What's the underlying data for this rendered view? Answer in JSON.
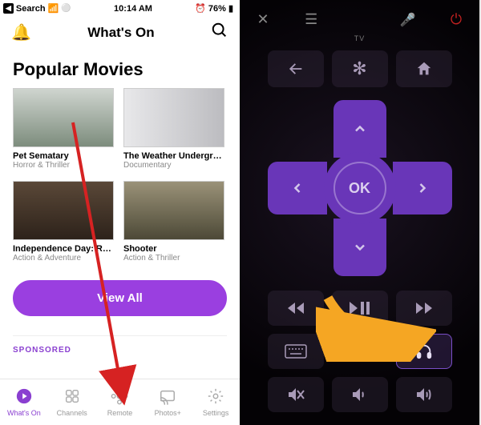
{
  "status": {
    "back": "Search",
    "time": "10:14 AM",
    "battery": "76%",
    "alarm": "⏰"
  },
  "header": {
    "title": "What's On"
  },
  "section_title": "Popular Movies",
  "movies": [
    {
      "title": "Pet Sematary",
      "genre": "Horror & Thriller"
    },
    {
      "title": "The Weather Undergro…",
      "genre": "Documentary"
    },
    {
      "title": "Independence Day: Res…",
      "genre": "Action & Adventure"
    },
    {
      "title": "Shooter",
      "genre": "Action & Thriller"
    }
  ],
  "view_all": "View All",
  "sponsored": "SPONSORED",
  "tabs": [
    {
      "label": "What's On"
    },
    {
      "label": "Channels"
    },
    {
      "label": "Remote"
    },
    {
      "label": "Photos+"
    },
    {
      "label": "Settings"
    }
  ],
  "remote": {
    "tv_label": "TV",
    "ok": "OK",
    "asterisk": "✻"
  }
}
